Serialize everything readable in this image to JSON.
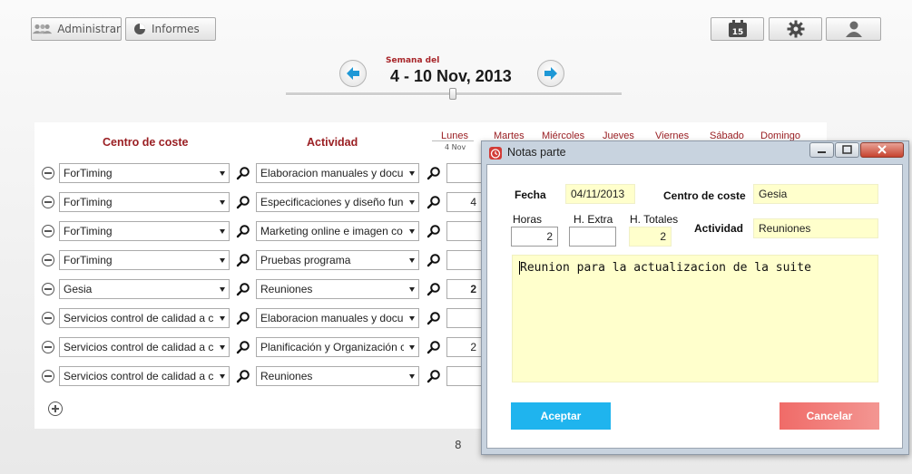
{
  "toolbar": {
    "admin_label": "Administrar",
    "reports_label": "Informes",
    "calendar_day": "15"
  },
  "week": {
    "label": "Semana del",
    "range": "4 - 10 Nov, 2013"
  },
  "table": {
    "headers": {
      "cost_center": "Centro de coste",
      "activity": "Actividad"
    },
    "days": [
      "Lunes",
      "Martes",
      "Miércoles",
      "Jueves",
      "Viernes",
      "Sábado",
      "Domingo"
    ],
    "first_day_date": "4 Nov",
    "rows": [
      {
        "cost_center": "ForTiming",
        "activity": "Elaboracion manuales y docu",
        "hours": ""
      },
      {
        "cost_center": "ForTiming",
        "activity": "Especificaciones y diseño func",
        "hours": "4"
      },
      {
        "cost_center": "ForTiming",
        "activity": "Marketing online e imagen co",
        "hours": ""
      },
      {
        "cost_center": "ForTiming",
        "activity": "Pruebas programa",
        "hours": ""
      },
      {
        "cost_center": "Gesia",
        "activity": "Reuniones",
        "hours": "2"
      },
      {
        "cost_center": "Servicios control de calidad a c",
        "activity": "Elaboracion manuales y docu",
        "hours": ""
      },
      {
        "cost_center": "Servicios control de calidad a c",
        "activity": "Planificación y Organización c",
        "hours": "2"
      },
      {
        "cost_center": "Servicios control de calidad a c",
        "activity": "Reuniones",
        "hours": ""
      }
    ],
    "page": "8"
  },
  "dialog": {
    "title": "Notas parte",
    "fecha_label": "Fecha",
    "fecha_value": "04/11/2013",
    "centro_label": "Centro de coste",
    "centro_value": "Gesia",
    "horas_label": "Horas",
    "horas_value": "2",
    "hextra_label": "H. Extra",
    "hextra_value": "",
    "htotales_label": "H. Totales",
    "htotales_value": "2",
    "actividad_label": "Actividad",
    "actividad_value": "Reuniones",
    "note_text": "Reunion para la actualizacion de la suite",
    "ok_label": "Aceptar",
    "cancel_label": "Cancelar"
  },
  "colors": {
    "accent_red": "#9a1f23",
    "ok_blue": "#1fb4ee",
    "cancel_red": "#f06b68",
    "readonly_yellow": "#ffffcc"
  }
}
